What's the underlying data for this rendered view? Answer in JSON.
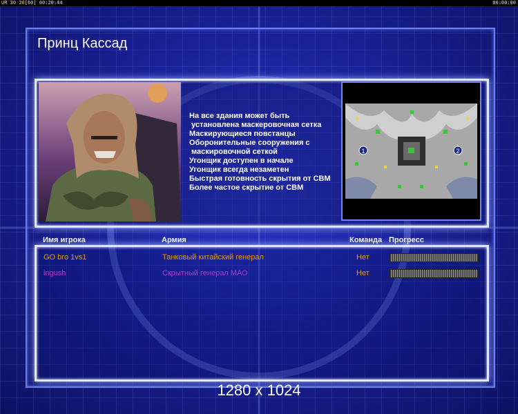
{
  "topbar": {
    "left_prefix": "UR",
    "left_a": "30",
    "left_b": "20",
    "left_c": "[60]",
    "left_time": "00:20:44",
    "right_time": "00:00:00"
  },
  "title": "Принц Кассад",
  "features": [
    "На все здания может быть",
    " установлена маскеровочная сетка",
    "Маскирующиеся повстанцы",
    "Оборонительные сооружения с",
    " маскировочной сеткой",
    "Угонщик доступен в начале",
    "Угонщик всегда незаметен",
    "Быстрая готовность скрытия от СВМ",
    "Более частое скрытие от СВМ"
  ],
  "minimap": {
    "marker1": "1",
    "marker2": "2"
  },
  "table": {
    "headers": {
      "name": "Имя игрока",
      "army": "Армия",
      "team": "Команда",
      "progress": "Прогресс"
    },
    "rows": [
      {
        "name": "GO bro 1vs1",
        "army": "Танковый китайский генерал",
        "team": "Нет",
        "color": "#e09a18",
        "progress": 1.0
      },
      {
        "name": "ingush",
        "army": "Скрытный генерал МАО",
        "team": "Нет",
        "color": "#b23cc8",
        "progress": 1.0
      }
    ]
  },
  "resolution": "1280 x 1024",
  "colors": {
    "background": "#1a2198",
    "frame": "#6f7fe6",
    "panel_border": "#dfe6ff"
  }
}
